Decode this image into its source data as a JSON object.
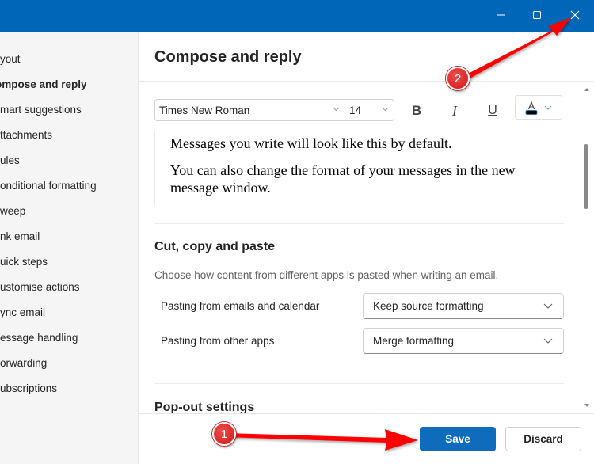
{
  "window": {
    "controls": [
      "minimize",
      "maximize",
      "close"
    ]
  },
  "sidebar": {
    "items": [
      {
        "label": "Layout",
        "visible": "yout"
      },
      {
        "label": "Compose and reply",
        "visible": "ompose and reply",
        "active": true
      },
      {
        "label": "Smart suggestions",
        "visible": "mart suggestions"
      },
      {
        "label": "Attachments",
        "visible": "ttachments"
      },
      {
        "label": "Rules",
        "visible": "ules"
      },
      {
        "label": "Conditional formatting",
        "visible": "onditional formatting"
      },
      {
        "label": "Sweep",
        "visible": "weep"
      },
      {
        "label": "Junk email",
        "visible": "nk email"
      },
      {
        "label": "Quick steps",
        "visible": "uick steps"
      },
      {
        "label": "Customise actions",
        "visible": "ustomise actions"
      },
      {
        "label": "Sync email",
        "visible": "ync email"
      },
      {
        "label": "Message handling",
        "visible": "essage handling"
      },
      {
        "label": "Forwarding",
        "visible": "orwarding"
      },
      {
        "label": "Subscriptions",
        "visible": "ubscriptions"
      }
    ]
  },
  "main": {
    "title": "Compose and reply",
    "message_format": {
      "font": "Times New Roman",
      "size": "14",
      "bold_label": "B",
      "italic_label": "I",
      "underline_label": "U",
      "font_color": "#000000",
      "preview_line1": "Messages you write will look like this by default.",
      "preview_line2": "You can also change the format of your messages in the new message window."
    },
    "cut_copy_paste": {
      "title": "Cut, copy and paste",
      "description": "Choose how content from different apps is pasted when writing an email.",
      "rows": [
        {
          "label": "Pasting from emails and calendar",
          "value": "Keep source formatting"
        },
        {
          "label": "Pasting from other apps",
          "value": "Merge formatting"
        }
      ]
    },
    "popout": {
      "title": "Pop-out settings"
    }
  },
  "footer": {
    "save_label": "Save",
    "discard_label": "Discard"
  },
  "annotations": [
    {
      "number": "1",
      "target": "Save button"
    },
    {
      "number": "2",
      "target": "Close window button"
    }
  ],
  "colors": {
    "titlebar": "#0067b8",
    "primary": "#0f6cbd",
    "annotation": "#e00000"
  }
}
